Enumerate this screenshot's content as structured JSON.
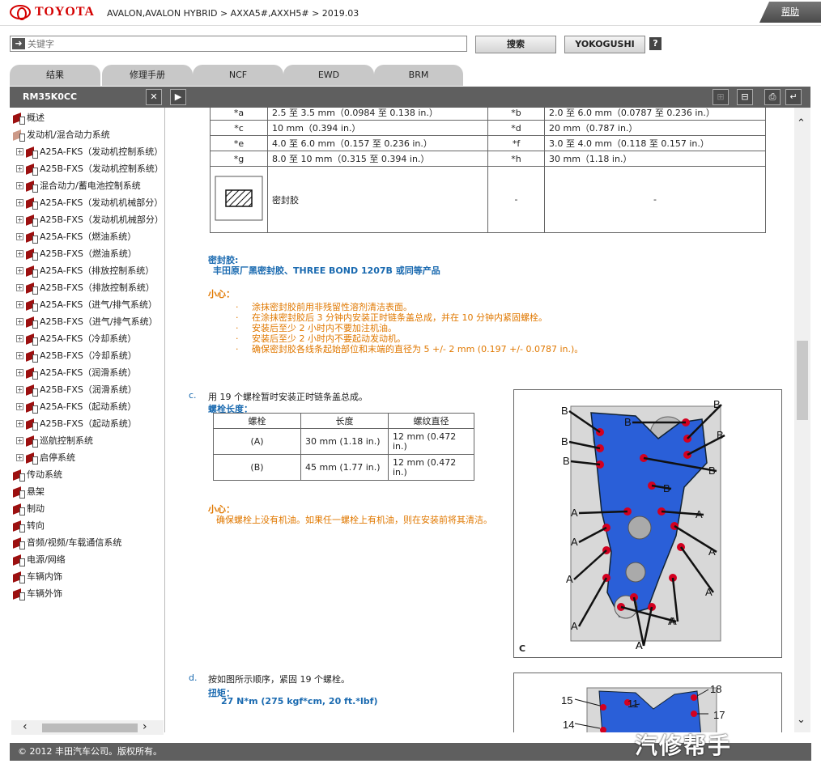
{
  "header": {
    "brand": "TOYOTA",
    "breadcrumb": "AVALON,AVALON HYBRID > AXXA5#,AXXH5# > 2019.03",
    "help": "帮助"
  },
  "search": {
    "placeholder": "关键字",
    "search_button": "搜索",
    "yokogushi_button": "YOKOGUSHI",
    "help_icon": "?"
  },
  "tabs": [
    "结果",
    "修理手册",
    "NCF",
    "EWD",
    "BRM"
  ],
  "toolbar": {
    "doc_id": "RM35K0CC"
  },
  "sidebar": {
    "items": [
      {
        "label": "概述",
        "level": 0
      },
      {
        "label": "发动机/混合动力系统",
        "level": 0
      },
      {
        "label": "A25A-FKS（发动机控制系统）",
        "level": 1
      },
      {
        "label": "A25B-FXS（发动机控制系统）",
        "level": 1
      },
      {
        "label": "混合动力/蓄电池控制系统",
        "level": 1
      },
      {
        "label": "A25A-FKS（发动机机械部分）",
        "level": 1
      },
      {
        "label": "A25B-FXS（发动机机械部分）",
        "level": 1
      },
      {
        "label": "A25A-FKS（燃油系统）",
        "level": 1
      },
      {
        "label": "A25B-FXS（燃油系统）",
        "level": 1
      },
      {
        "label": "A25A-FKS（排放控制系统）",
        "level": 1
      },
      {
        "label": "A25B-FXS（排放控制系统）",
        "level": 1
      },
      {
        "label": "A25A-FKS（进气/排气系统）",
        "level": 1
      },
      {
        "label": "A25B-FXS（进气/排气系统）",
        "level": 1
      },
      {
        "label": "A25A-FKS（冷却系统）",
        "level": 1
      },
      {
        "label": "A25B-FXS（冷却系统）",
        "level": 1
      },
      {
        "label": "A25A-FKS（润滑系统）",
        "level": 1
      },
      {
        "label": "A25B-FXS（润滑系统）",
        "level": 1
      },
      {
        "label": "A25A-FKS（起动系统）",
        "level": 1
      },
      {
        "label": "A25B-FXS（起动系统）",
        "level": 1
      },
      {
        "label": "巡航控制系统",
        "level": 1
      },
      {
        "label": "启停系统",
        "level": 1
      },
      {
        "label": "传动系统",
        "level": 0
      },
      {
        "label": "悬架",
        "level": 0
      },
      {
        "label": "制动",
        "level": 0
      },
      {
        "label": "转向",
        "level": 0
      },
      {
        "label": "音频/视频/车载通信系统",
        "level": 0
      },
      {
        "label": "电源/网络",
        "level": 0
      },
      {
        "label": "车辆内饰",
        "level": 0
      },
      {
        "label": "车辆外饰",
        "level": 0
      }
    ]
  },
  "spec_table": {
    "rows": [
      [
        "*a",
        "2.5 至 3.5 mm（0.0984 至 0.138 in.）",
        "*b",
        "2.0 至 6.0 mm（0.0787 至 0.236 in.）"
      ],
      [
        "*c",
        "10 mm（0.394 in.）",
        "*d",
        "20 mm（0.787 in.）"
      ],
      [
        "*e",
        "4.0 至 6.0 mm（0.157 至 0.236 in.）",
        "*f",
        "3.0 至 4.0 mm（0.118 至 0.157 in.）"
      ],
      [
        "*g",
        "8.0 至 10 mm（0.315 至 0.394 in.）",
        "*h",
        "30 mm（1.18 in.）"
      ]
    ],
    "sealant_label": "密封胶",
    "dash1": "-",
    "dash2": "-"
  },
  "sealant": {
    "title": "密封胶:",
    "value": "丰田原厂黑密封胶、THREE BOND 1207B 或同等产品"
  },
  "caution1": {
    "title": "小心：",
    "items": [
      "涂抹密封胶前用非残留性溶剂清洁表面。",
      "在涂抹密封胶后 3 分钟内安装正时链条盖总成，并在 10 分钟内紧固螺栓。",
      "安装后至少 2 小时内不要加注机油。",
      "安装后至少 2 小时内不要起动发动机。",
      "确保密封胶各线条起始部位和末端的直径为 5 +/- 2 mm (0.197 +/- 0.0787 in.)。"
    ]
  },
  "step_c": {
    "letter": "c.",
    "text": "用 19 个螺栓暂时安装正时链条盖总成。",
    "bolt_len_title": "螺栓长度：",
    "headers": [
      "螺栓",
      "长度",
      "螺纹直径"
    ],
    "rows": [
      [
        "(A)",
        "30 mm (1.18 in.)",
        "12 mm (0.472 in.)"
      ],
      [
        "(B)",
        "45 mm (1.77 in.)",
        "12 mm (0.472 in.)"
      ]
    ],
    "caution_title": "小心：",
    "caution_text": "确保螺栓上没有机油。如果任一螺栓上有机油，则在安装前将其清洁。",
    "figure_label": "C"
  },
  "step_d": {
    "letter": "d.",
    "text": "按如图所示顺序，紧固 19 个螺栓。",
    "torque_title": "扭矩：",
    "torque_value": "27 N*m (275 kgf*cm, 20 ft.*lbf)"
  },
  "figure1_callouts": [
    "B",
    "B",
    "B",
    "B",
    "B",
    "B",
    "B",
    "B",
    "A",
    "A",
    "A",
    "A",
    "A",
    "A",
    "A",
    "A",
    "A",
    "A",
    "A"
  ],
  "figure2_callouts": [
    "15",
    "11",
    "18",
    "17",
    "14"
  ],
  "footer": {
    "copyright": "© 2012 丰田汽车公司。版权所有。"
  },
  "watermark": "汽修帮手",
  "colors": {
    "toolbar": "#5f5f5f",
    "caution": "#e07800",
    "heading_blue": "#1a6ab0",
    "cover_blue": "#2a5fd8",
    "bolt_red": "#d30020"
  }
}
